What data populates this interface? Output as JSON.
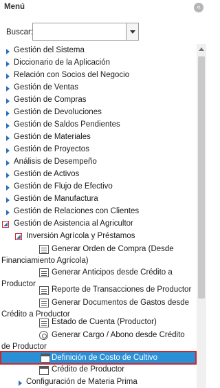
{
  "panel": {
    "title": "Menú",
    "collapse_glyph": "«",
    "collapse_icon": "double-chevron-left-icon"
  },
  "search": {
    "label": "Buscar:",
    "value": "",
    "placeholder": ""
  },
  "tree": {
    "top_items": [
      "Gestión del Sistema",
      "Diccionario de la Aplicación",
      "Relación con Socios del Negocio",
      "Gestión de Ventas",
      "Gestión de Compras",
      "Gestión de Devoluciones",
      "Gestión de Saldos Pendientes",
      "Gestión de Materiales",
      "Gestión de Proyectos",
      "Análisis de Desempeño",
      "Gestión de Activos",
      "Gestión de Flujo de Efectivo",
      "Gestión de Manufactura",
      "Gestión de Relaciones con Clientes"
    ],
    "expanded_item": "Gestión de Asistencia al Agricultor",
    "sub_expanded": "Inversión Agrícola y Préstamos",
    "leaves": [
      {
        "label": "Generar Orden de Compra (Desde Financiamiento Agrícola)",
        "icon": "process-icon"
      },
      {
        "label": "Generar Anticipos desde Crédito a Productor",
        "icon": "process-icon"
      },
      {
        "label": "Reporte de Transacciones de Productor",
        "icon": "report-icon"
      },
      {
        "label": "Generar Documentos de Gastos desde Crédito a Productor",
        "icon": "process-icon"
      },
      {
        "label": "Estado de Cuenta (Productor)",
        "icon": "report-icon"
      },
      {
        "label": "Generar Cargo / Abono desde Crédito de Productor",
        "icon": "gear-icon"
      },
      {
        "label": "Definición de Costo de Cultivo",
        "icon": "window-icon",
        "selected": true
      },
      {
        "label": "Crédito de Productor",
        "icon": "window-icon"
      }
    ],
    "after_item": "Configuración de Materia Prima"
  },
  "colors": {
    "selection": "#2a90d6",
    "highlight_border": "#d0262b",
    "arrow": "#2a6fb8"
  }
}
